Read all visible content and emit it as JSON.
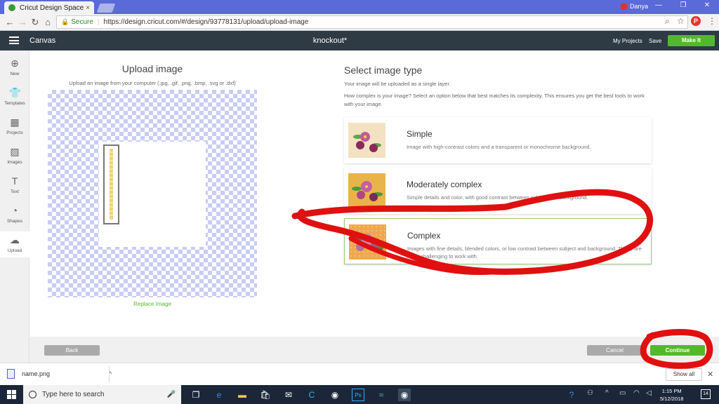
{
  "browser": {
    "tab_title": "Cricut Design Space",
    "tab_close": "×",
    "profile_name": "Danya",
    "window_controls": [
      "—",
      "❐",
      "✕"
    ],
    "nav": {
      "back": "←",
      "forward": "→",
      "reload": "↻",
      "home": "⌂"
    },
    "secure_label": "Secure",
    "url": "https://design.cricut.com/#/design/93778131/upload/upload-image",
    "omni_icons": {
      "search": "⌕",
      "star": "☆",
      "menu": "⋮"
    },
    "pinterest_label": "P"
  },
  "app_header": {
    "canvas_label": "Canvas",
    "project_name": "knockout*",
    "my_projects": "My Projects",
    "save": "Save",
    "make_it": "Make It"
  },
  "sidebar": {
    "items": [
      {
        "label": "New",
        "icon": "plus-icon",
        "glyph": "⊕"
      },
      {
        "label": "Templates",
        "icon": "shirt-icon",
        "glyph": "👕"
      },
      {
        "label": "Projects",
        "icon": "projects-icon",
        "glyph": "▦"
      },
      {
        "label": "Images",
        "icon": "image-icon",
        "glyph": "▨"
      },
      {
        "label": "Text",
        "icon": "text-icon",
        "glyph": "T"
      },
      {
        "label": "Shapes",
        "icon": "shapes-icon",
        "glyph": "◔"
      },
      {
        "label": "Upload",
        "icon": "upload-cloud-icon",
        "glyph": "☁"
      }
    ]
  },
  "upload": {
    "title": "Upload image",
    "subtitle": "Upload an image from your computer (.jpg, .gif, .png, .bmp, .svg or .dxf)",
    "replace_link": "Replace Image"
  },
  "select_type": {
    "title": "Select image type",
    "p1": "Your image will be uploaded as a single layer.",
    "p2": "How complex is your image? Select an option below that best matches its complexity. This ensures you get the best tools to work with your image.",
    "options": [
      {
        "name": "Simple",
        "desc": "Image with high-contrast colors and a transparent or monochrome background.",
        "thumb_bg": "#f2e2c2"
      },
      {
        "name": "Moderately complex",
        "desc": "Simple details and color, with good contrast between subject and background.",
        "thumb_bg": "#e8b44a"
      },
      {
        "name": "Complex",
        "desc": "Images with fine details, blended colors, or low contrast between subject and background. These are more challenging to work with.",
        "thumb_bg": "#f0a850",
        "selected": true
      }
    ]
  },
  "footer": {
    "back": "Back",
    "cancel": "Cancel",
    "continue": "Continue"
  },
  "download_shelf": {
    "filename": "name.png",
    "chevron": "^",
    "show_all": "Show all",
    "close": "✕"
  },
  "taskbar": {
    "search_placeholder": "Type here to search",
    "time": "1:15 PM",
    "date": "5/12/2018",
    "notification_count": "14"
  },
  "colors": {
    "accent_green": "#53b92c",
    "header_dark": "#2e3a44",
    "annotation_red": "#e01010"
  }
}
